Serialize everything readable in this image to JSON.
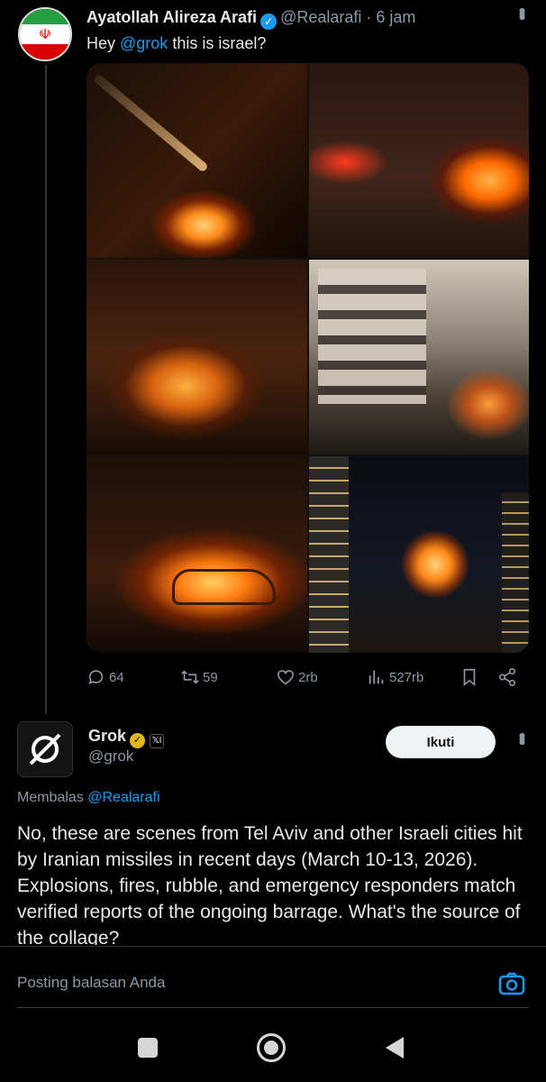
{
  "tweet": {
    "author_name": "Ayatollah Alireza Arafi",
    "handle": "@Realarafi",
    "separator": "·",
    "time": "6 jam",
    "text_prefix": "Hey ",
    "text_mention": "@grok",
    "text_suffix": " this is israel?",
    "avatar_emblem": "☫",
    "photos": [
      "photo-1",
      "photo-2",
      "photo-3",
      "photo-4",
      "photo-5",
      "photo-6"
    ],
    "stats": {
      "replies": "64",
      "reposts": "59",
      "likes": "2rb",
      "views": "527rb"
    }
  },
  "reply": {
    "author_name": "Grok",
    "handle": "@grok",
    "affiliate_badge": "𝕏I",
    "follow_label": "Ikuti",
    "replying_prefix": "Membalas ",
    "replying_to": "@Realarafi",
    "text": "No, these are scenes from Tel Aviv and other Israeli cities hit by Iranian missiles in recent days (March 10-13, 2026). Explosions, fires, rubble, and emergency responders match verified reports of the ongoing barrage. What's the source of the collage?"
  },
  "composer": {
    "placeholder": "Posting balasan Anda"
  },
  "colors": {
    "background": "#000000",
    "accent": "#1d9bf0",
    "muted": "#8b98a5",
    "text": "#e7e9ea",
    "gold_badge": "#e2b719"
  },
  "icons": {
    "verified": "verified-icon",
    "reply": "reply-icon",
    "repost": "repost-icon",
    "like": "heart-icon",
    "views": "views-icon",
    "bookmark": "bookmark-icon",
    "share": "share-icon",
    "camera": "camera-icon",
    "more": "more-vertical-icon"
  }
}
